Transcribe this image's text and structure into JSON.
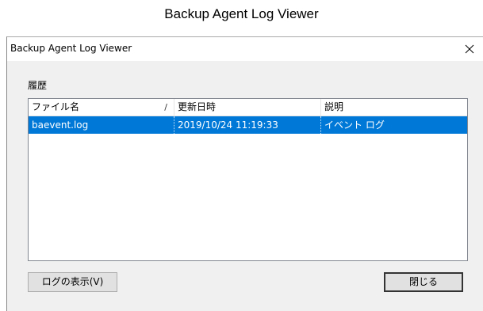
{
  "caption": "Backup Agent Log Viewer",
  "window": {
    "title": "Backup Agent Log Viewer",
    "close_icon": "close-icon"
  },
  "history": {
    "label": "履歴",
    "columns": [
      {
        "label": "ファイル名",
        "sort": "/"
      },
      {
        "label": "更新日時"
      },
      {
        "label": "説明"
      }
    ],
    "rows": [
      {
        "file": "baevent.log",
        "modified": "2019/10/24 11:19:33",
        "description": "イベント ログ",
        "selected": true
      }
    ]
  },
  "buttons": {
    "show_log": "ログの表示(V)",
    "close": "閉じる"
  },
  "colors": {
    "selection": "#0078d7",
    "window_bg": "#f0f0f0"
  }
}
